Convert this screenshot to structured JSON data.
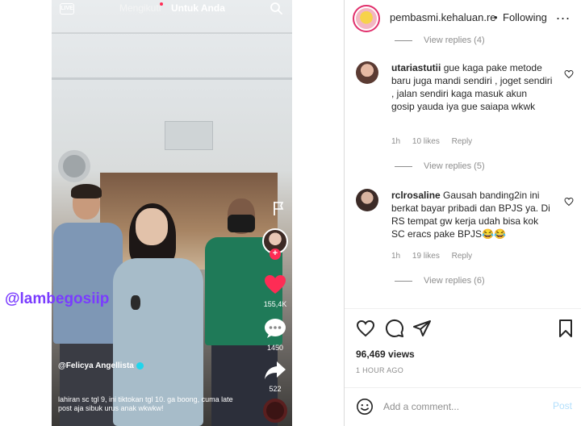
{
  "tiktok": {
    "live_label": "LIVE",
    "tab_following": "Mengikuti",
    "tab_for_you": "Untuk Anda",
    "likes": "155,4K",
    "comments": "1450",
    "shares": "522",
    "username": "@Felicya Angellista",
    "caption": "lahiran sc tgl 9, ini tiktokan tgl 10. ga boong, cuma late post aja sibuk urus anak wkwkw!",
    "watermark": "@lambegosiip",
    "accent_color": "#fe2c55"
  },
  "instagram": {
    "header": {
      "username": "pembasmi.kehaluan.re",
      "separator": "•",
      "follow_state": "Following",
      "more": "..."
    },
    "view_replies_top": "View replies (4)",
    "comments": [
      {
        "user": "utariastutii",
        "text": "gue kaga pake metode baru juga mandi sendiri , joget sendiri , jalan sendiri kaga masuk akun gosip yauda iya gue saiapa wkwk",
        "time": "1h",
        "likes": "10 likes",
        "reply": "Reply",
        "view_replies": "View replies (5)"
      },
      {
        "user": "rclrosaline",
        "text": "Gausah banding2in ini berkat bayar pribadi dan BPJS ya. Di RS tempat gw kerja udah bisa kok SC eracs pake BPJS😂😂",
        "time": "1h",
        "likes": "19 likes",
        "reply": "Reply",
        "view_replies": "View replies (6)"
      }
    ],
    "views": "96,469 views",
    "time_ago": "1 HOUR AGO",
    "add_comment_placeholder": "Add a comment...",
    "post_label": "Post"
  }
}
